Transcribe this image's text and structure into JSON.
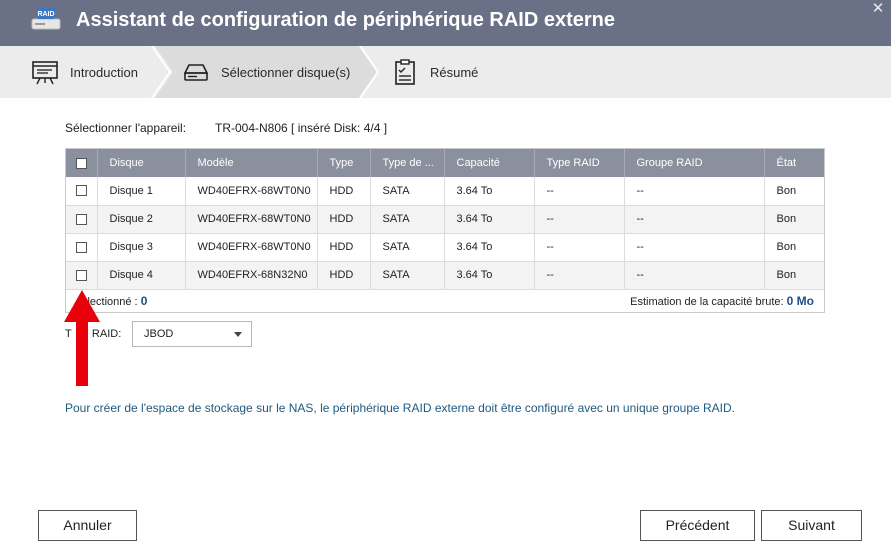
{
  "window": {
    "title": "Assistant de configuration de périphérique RAID externe",
    "app_icon_text": "RAID",
    "close_glyph": "✕"
  },
  "steps": [
    {
      "label": "Introduction",
      "icon": "presentation-board-icon",
      "active": false
    },
    {
      "label": "Sélectionner disque(s)",
      "icon": "drive-icon",
      "active": true
    },
    {
      "label": "Résumé",
      "icon": "clipboard-checklist-icon",
      "active": false
    }
  ],
  "device": {
    "label": "Sélectionner l'appareil:",
    "value": "TR-004-N806 [ inséré Disk: 4/4 ]"
  },
  "table": {
    "headers": [
      "Disque",
      "Modèle",
      "Type",
      "Type de ...",
      "Capacité",
      "Type RAID",
      "Groupe RAID",
      "État"
    ],
    "rows": [
      {
        "disk": "Disque 1",
        "model": "WD40EFRX-68WT0N0",
        "type": "HDD",
        "interface": "SATA",
        "capacity": "3.64 To",
        "raid_type": "--",
        "raid_group": "--",
        "state": "Bon"
      },
      {
        "disk": "Disque 2",
        "model": "WD40EFRX-68WT0N0",
        "type": "HDD",
        "interface": "SATA",
        "capacity": "3.64 To",
        "raid_type": "--",
        "raid_group": "--",
        "state": "Bon"
      },
      {
        "disk": "Disque 3",
        "model": "WD40EFRX-68WT0N0",
        "type": "HDD",
        "interface": "SATA",
        "capacity": "3.64 To",
        "raid_type": "--",
        "raid_group": "--",
        "state": "Bon"
      },
      {
        "disk": "Disque 4",
        "model": "WD40EFRX-68N32N0",
        "type": "HDD",
        "interface": "SATA",
        "capacity": "3.64 To",
        "raid_type": "--",
        "raid_group": "--",
        "state": "Bon"
      }
    ],
    "footer": {
      "selected_label": "lectionné :",
      "selected_count": "0",
      "capacity_label": "Estimation de la capacité brute:",
      "capacity_value": "0 Mo"
    }
  },
  "raid": {
    "label_start": "T",
    "label_end": "RAID:",
    "selected": "JBOD"
  },
  "info_text": "Pour créer de l'espace de stockage sur le NAS, le périphérique RAID externe doit être configuré avec un unique groupe RAID.",
  "buttons": {
    "cancel": "Annuler",
    "previous": "Précédent",
    "next": "Suivant"
  },
  "colors": {
    "titlebar": "#6a7187",
    "table_header": "#8b909f",
    "info_text": "#1f5a80",
    "annotation_arrow": "#e8000a"
  }
}
